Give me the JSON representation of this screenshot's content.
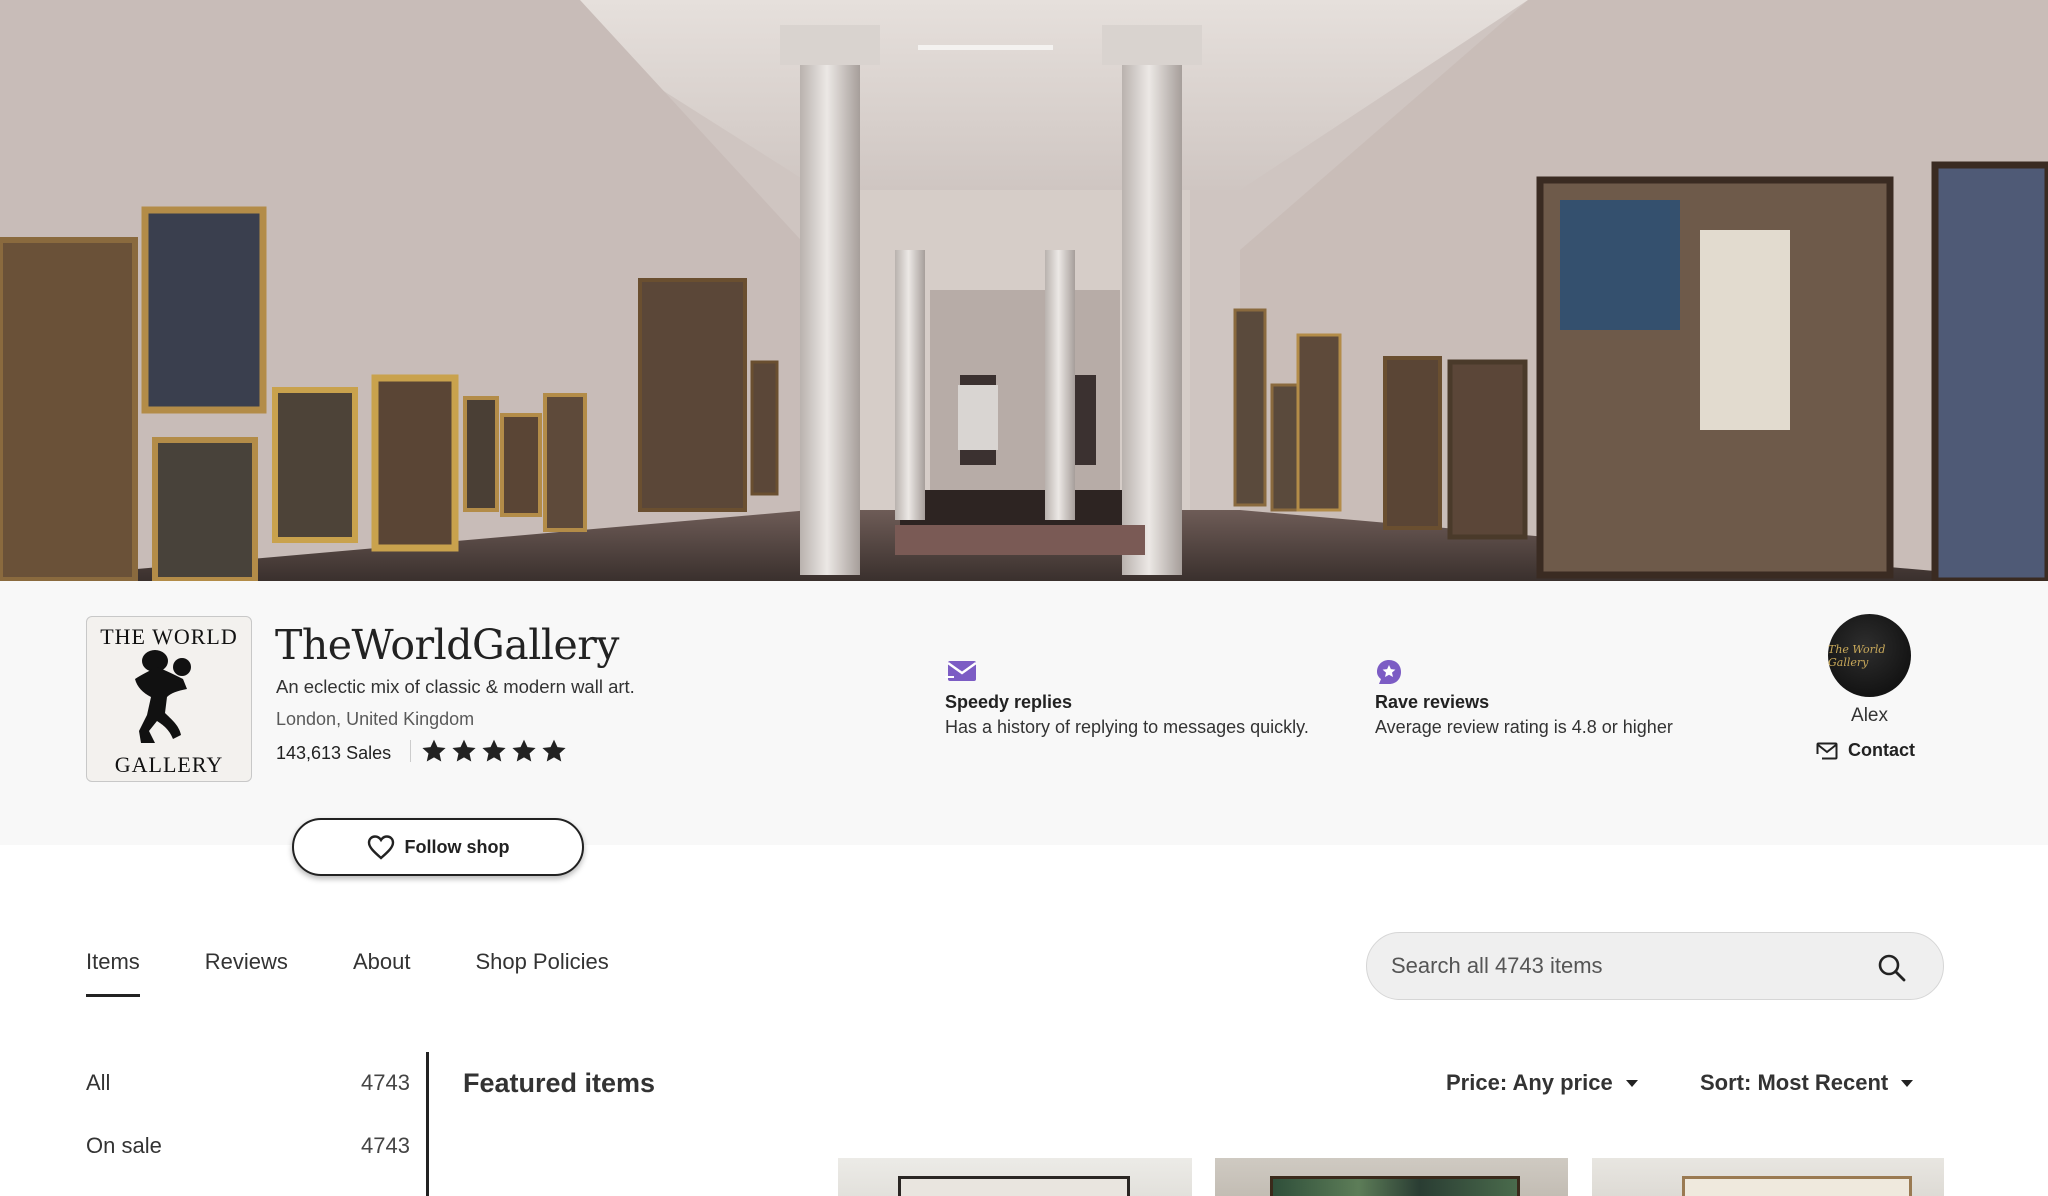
{
  "shop": {
    "logo_top": "THE WORLD",
    "logo_bottom": "GALLERY",
    "name": "TheWorldGallery",
    "tagline": "An eclectic mix of classic & modern wall art.",
    "location": "London, United Kingdom",
    "sales": "143,613 Sales",
    "rating_stars": 5
  },
  "badges": {
    "speedy_title": "Speedy replies",
    "speedy_desc": "Has a history of replying to messages quickly.",
    "rave_title": "Rave reviews",
    "rave_desc": "Average review rating is 4.8 or higher"
  },
  "owner": {
    "avatar_text": "The World Gallery",
    "name": "Alex",
    "contact_label": "Contact"
  },
  "follow_label": "Follow shop",
  "tabs": [
    {
      "label": "Items",
      "active": true
    },
    {
      "label": "Reviews",
      "active": false
    },
    {
      "label": "About",
      "active": false
    },
    {
      "label": "Shop Policies",
      "active": false
    }
  ],
  "search": {
    "placeholder": "Search all 4743 items"
  },
  "sidebar": [
    {
      "label": "All",
      "count": "4743"
    },
    {
      "label": "On sale",
      "count": "4743"
    }
  ],
  "featured_title": "Featured items",
  "filters": {
    "price": "Price: Any price",
    "sort": "Sort: Most Recent"
  },
  "colors": {
    "badge_purple": "#7c5cc4",
    "text_dark": "#222222",
    "header_bg": "#f8f8f8"
  }
}
